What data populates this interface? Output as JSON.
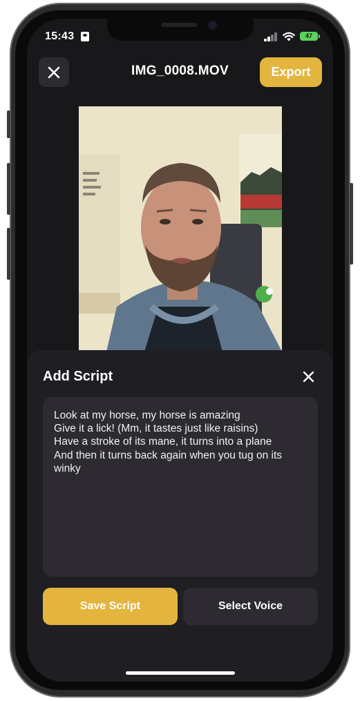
{
  "status_bar": {
    "time": "15:43",
    "battery": "47"
  },
  "header": {
    "title": "IMG_0008.MOV",
    "export_label": "Export"
  },
  "script_sheet": {
    "title": "Add Script",
    "script_text": "Look at my horse, my horse is amazing\nGive it a lick! (Mm, it tastes just like raisins)\nHave a stroke of its mane, it turns into a plane\nAnd then it turns back again when you tug on its winky",
    "save_label": "Save Script",
    "voice_label": "Select Voice"
  },
  "colors": {
    "accent": "#e3b53f",
    "background": "#18181b",
    "sheet": "#1f1e23",
    "field": "#2d2a31"
  },
  "icons": {
    "close": "close-icon",
    "sheet_close": "close-icon",
    "signal": "signal-icon",
    "wifi": "wifi-icon",
    "battery": "battery-icon",
    "id_card": "id-card-icon"
  }
}
